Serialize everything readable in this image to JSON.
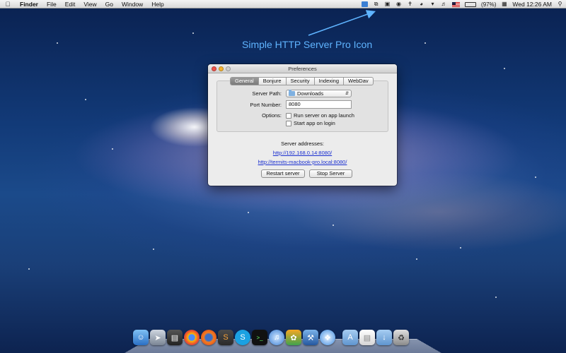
{
  "menubar": {
    "app_name": "Finder",
    "menus": [
      "File",
      "Edit",
      "View",
      "Go",
      "Window",
      "Help"
    ],
    "battery": "(97%)",
    "clock": "Wed 12:26 AM"
  },
  "annotation": {
    "text": "Simple HTTP Server Pro Icon",
    "color": "#5fb4ff"
  },
  "window": {
    "title": "Preferences",
    "tabs": [
      "General",
      "Bonjure",
      "Security",
      "Indexing",
      "WebDav"
    ],
    "active_tab": "General",
    "server_path_label": "Server Path:",
    "server_path_value": "Downloads",
    "port_label": "Port Number:",
    "port_value": "8080",
    "options_label": "Options:",
    "option_launch": "Run server on app launch",
    "option_login": "Start app on login",
    "addresses_label": "Server addresses:",
    "address_1": "http://192.168.0.14:8080/",
    "address_2": "http://termits-macbook-pro.local:8080/",
    "restart_button": "Restart server",
    "stop_button": "Stop Server"
  },
  "dock": {
    "icons": [
      "finder-icon",
      "rocket-icon",
      "app-icon",
      "chrome-icon",
      "firefox-icon",
      "sublime-icon",
      "skype-icon",
      "terminal-icon",
      "itunes-icon",
      "app2-icon",
      "xcode-icon",
      "safari-icon",
      "applications-folder-icon",
      "document-icon",
      "downloads-folder-icon",
      "trash-icon"
    ]
  }
}
